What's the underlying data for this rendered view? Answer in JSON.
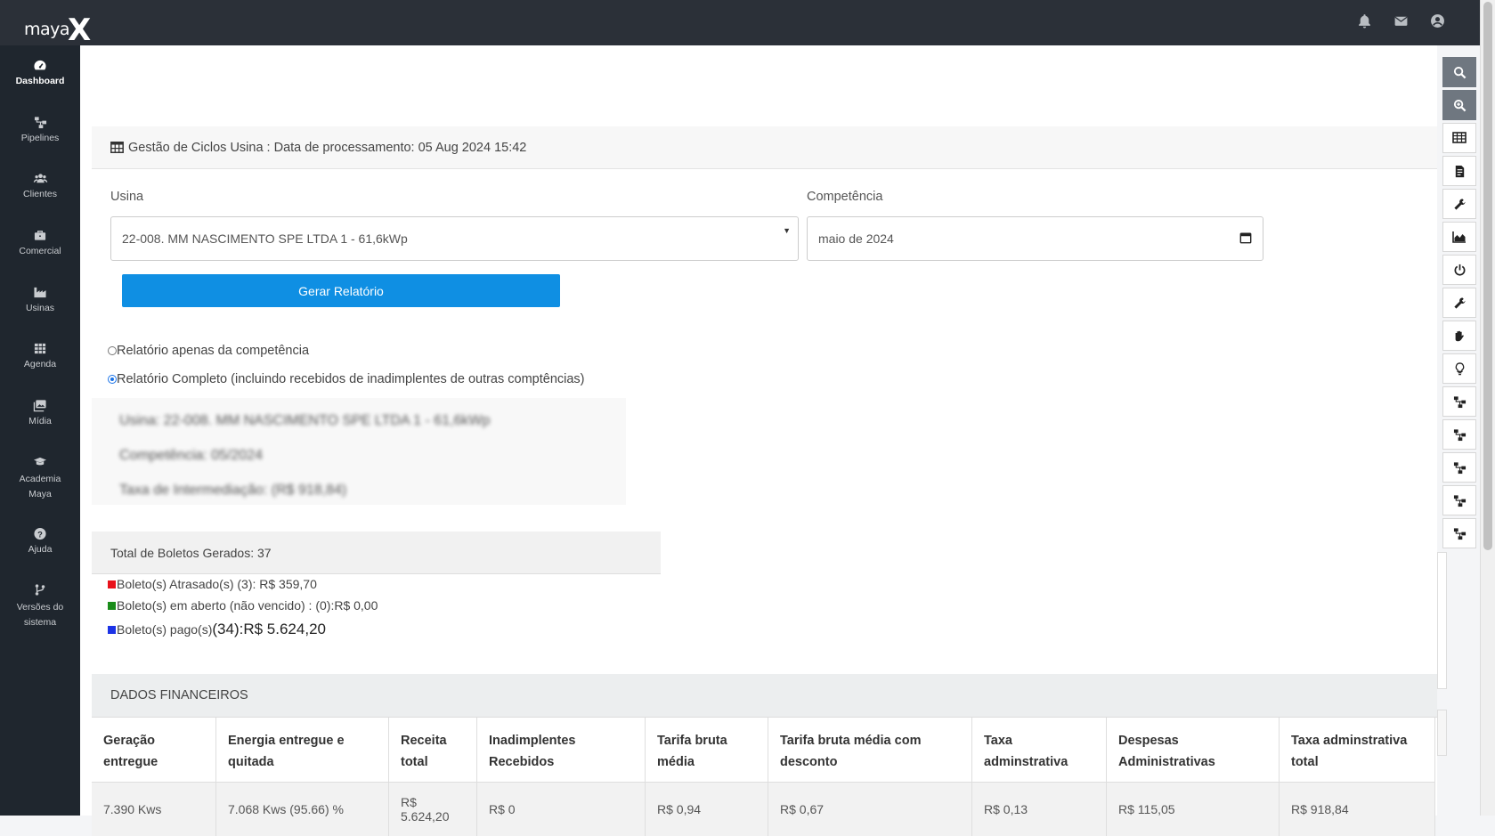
{
  "app": {
    "logo_text": "maya",
    "logo_mark": "X"
  },
  "topbar": {
    "icons": [
      "bell-icon",
      "envelope-icon",
      "user-circle-icon"
    ]
  },
  "sidebar": {
    "items": [
      {
        "label": "Dashboard",
        "icon": "dashboard-gauge-icon",
        "active": true
      },
      {
        "label": "Pipelines",
        "icon": "sitemap-icon"
      },
      {
        "label": "Clientes",
        "icon": "users-icon"
      },
      {
        "label": "Comercial",
        "icon": "briefcase-icon"
      },
      {
        "label": "Usinas",
        "icon": "industry-icon"
      },
      {
        "label": "Agenda",
        "icon": "calendar-grid-icon"
      },
      {
        "label": "Mídia",
        "icon": "images-icon"
      },
      {
        "label": "Academia Maya",
        "icon": "graduation-cap-icon"
      },
      {
        "label": "Ajuda",
        "icon": "question-circle-icon"
      },
      {
        "label": "Versões do sistema",
        "icon": "code-branch-icon"
      }
    ]
  },
  "tools": [
    "search-icon",
    "zoom-in-icon",
    "table-icon",
    "file-invoice-icon",
    "wrench-icon",
    "chart-area-icon",
    "power-icon",
    "wrench-icon",
    "hand-icon",
    "lightbulb-icon",
    "sitemap-icon",
    "sitemap-icon",
    "sitemap-icon",
    "sitemap-icon",
    "sitemap-icon"
  ],
  "panel": {
    "title": "Gestão de Ciclos Usina : Data de processamento: 05 Aug 2024 15:42",
    "usina_label": "Usina",
    "usina_value": "22-008. MM NASCIMENTO SPE LTDA 1 - 61,6kWp",
    "competencia_label": "Competência",
    "competencia_value": "maio de 2024",
    "generate_button": "Gerar Relatório",
    "radio_competencia": "Relatório apenas da competência",
    "radio_completo": "Relatório Completo (incluindo recebidos de inadimplentes de outras comptências)"
  },
  "report_info": {
    "usina": "Usina: 22-008. MM NASCIMENTO SPE LTDA 1 - 61,6kWp",
    "competencia": "Competência: 05/2024",
    "taxa": "Taxa de Intermediação: (R$ 918,84)"
  },
  "boletos": {
    "total": "Total de Boletos Gerados: 37",
    "atrasados": "Boleto(s) Atrasado(s) (3): R$ 359,70",
    "aberto": "Boleto(s) em aberto (não vencido) : (0):R$ 0,00",
    "pagos_prefix": "Boleto(s) pago(s) ",
    "pagos_value": "(34):R$ 5.624,20",
    "colors": {
      "atrasados": "#e8121b",
      "aberto": "#1a8c1a",
      "pagos": "#1c33e6"
    }
  },
  "financeiro": {
    "title": "DADOS FINANCEIROS",
    "headers": [
      "Geração entregue",
      "Energia entregue e quitada",
      "Receita total",
      "Inadimplentes Recebidos",
      "Tarifa bruta média",
      "Tarifa bruta média com desconto",
      "Taxa adminstrativa",
      "Despesas Administrativas",
      "Taxa adminstrativa total"
    ],
    "row": [
      "7.390 Kws",
      "7.068 Kws (95.66) %",
      "R$ 5.624,20",
      "R$ 0",
      "R$ 0,94",
      "R$ 0,67",
      "R$ 0,13",
      "R$ 115,05",
      "R$ 918,84"
    ]
  },
  "colors": {
    "topbar": "#2b3038",
    "sidebar": "#1f262e",
    "primary": "#0f8fe3"
  }
}
